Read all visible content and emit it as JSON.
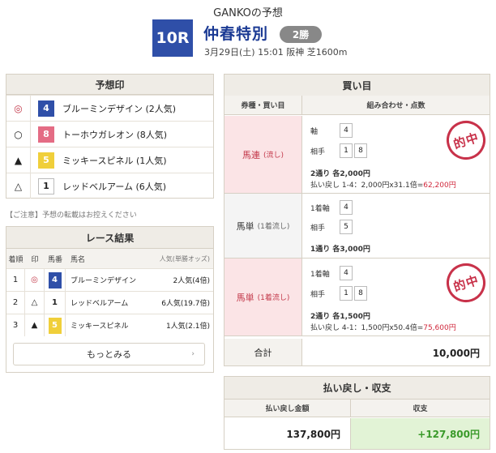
{
  "header": {
    "title": "GANKOの予想",
    "race_number": "10R",
    "race_name": "仲春特別",
    "class_badge": "2勝",
    "race_info": "3月29日(土) 15:01 阪神 芝1600m"
  },
  "prediction": {
    "title": "予想印",
    "rows": [
      {
        "mark": "◎",
        "num": "4",
        "num_bg": "#2f4fa8",
        "num_fg": "#ffffff",
        "name": "ブルーミンデザイン (2人気)"
      },
      {
        "mark": "○",
        "num": "8",
        "num_bg": "#e46c84",
        "num_fg": "#ffffff",
        "name": "トーホウガレオン (8人気)"
      },
      {
        "mark": "▲",
        "num": "5",
        "num_bg": "#f0cf3a",
        "num_fg": "#ffffff",
        "name": "ミッキースピネル (1人気)"
      },
      {
        "mark": "△",
        "num": "1",
        "num_bg": "#ffffff",
        "num_fg": "#222222",
        "name": "レッドベルアーム (6人気)"
      }
    ],
    "note": "【ご注意】予想の転載はお控えください"
  },
  "result": {
    "title": "レース結果",
    "headers": {
      "rank": "着順",
      "mark": "印",
      "num": "馬番",
      "name": "馬名",
      "pop": "人気(単勝オッズ)"
    },
    "rows": [
      {
        "rank": "1",
        "mark": "◎",
        "num": "4",
        "num_bg": "#2f4fa8",
        "num_fg": "#ffffff",
        "name": "ブルーミンデザイン",
        "pop": "2人気(4倍)"
      },
      {
        "rank": "2",
        "mark": "△",
        "num": "1",
        "num_bg": "#ffffff",
        "num_fg": "#222222",
        "name": "レッドベルアーム",
        "pop": "6人気(19.7倍)"
      },
      {
        "rank": "3",
        "mark": "▲",
        "num": "5",
        "num_bg": "#f0cf3a",
        "num_fg": "#ffffff",
        "name": "ミッキースピネル",
        "pop": "1人気(2.1倍)"
      }
    ],
    "more_label": "もっとみる",
    "more_arrow": "›"
  },
  "bets": {
    "title": "買い目",
    "col_type": "券種・買い目",
    "col_combo": "組み合わせ・点数",
    "stamp_text": "的中",
    "blocks": [
      {
        "type": "馬連",
        "type_sub": "(流し)",
        "hit": true,
        "axis_label": "軸",
        "axis": [
          "4"
        ],
        "partner_label": "相手",
        "partners": [
          "1",
          "8"
        ],
        "summary": "2通り 各2,000円",
        "payout_prefix": "払い戻し 1-4：2,000円x31.1倍=",
        "payout_value": "62,200円"
      },
      {
        "type": "馬単",
        "type_sub": "(1着流し)",
        "hit": false,
        "axis_label": "1着軸",
        "axis": [
          "4"
        ],
        "partner_label": "相手",
        "partners": [
          "5"
        ],
        "summary": "1通り 各3,000円"
      },
      {
        "type": "馬単",
        "type_sub": "(1着流し)",
        "hit": true,
        "axis_label": "1着軸",
        "axis": [
          "4"
        ],
        "partner_label": "相手",
        "partners": [
          "1",
          "8"
        ],
        "summary": "2通り 各1,500円",
        "payout_prefix": "払い戻し 4-1：1,500円x50.4倍=",
        "payout_value": "75,600円"
      }
    ],
    "total_label": "合計",
    "total_value": "10,000円"
  },
  "payout": {
    "title": "払い戻し・収支",
    "col_payout": "払い戻し金額",
    "col_balance": "収支",
    "payout_value": "137,800円",
    "balance_value": "+127,800円",
    "balance_color": "#3a9a2a"
  }
}
